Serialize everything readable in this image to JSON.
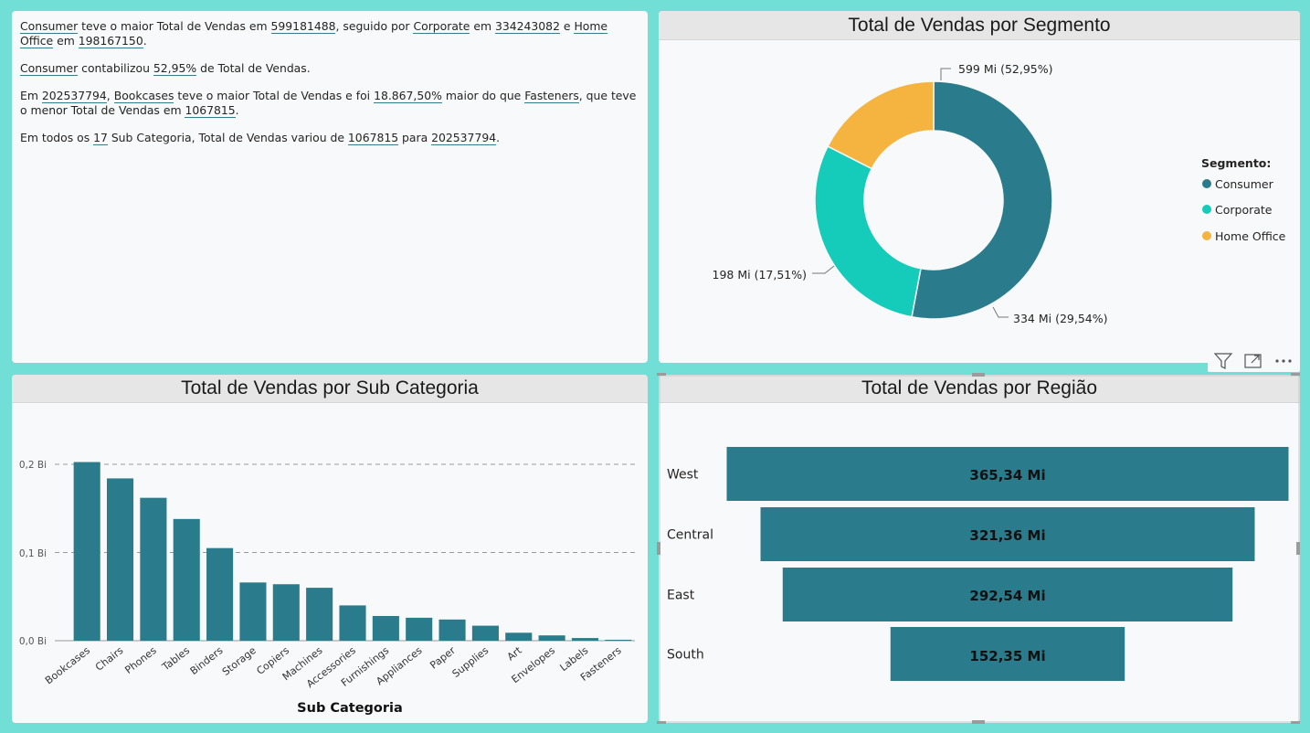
{
  "narrative": {
    "p1": {
      "a": "Consumer",
      "b": " teve o maior Total de Vendas em ",
      "c": "599181488",
      "d": ", seguido por ",
      "e": "Corporate",
      "f": " em ",
      "g": "334243082",
      "h": " e ",
      "i": "Home Office",
      "j": " em ",
      "k": "198167150",
      "l": "."
    },
    "p2": {
      "a": "Consumer",
      "b": " contabilizou ",
      "c": "52,95%",
      "d": " de Total de Vendas."
    },
    "p3": {
      "a": "Em ",
      "b": "202537794",
      "c": ", ",
      "d": "Bookcases",
      "e": " teve o maior Total de Vendas e foi ",
      "f": "18.867,50%",
      "g": " maior do que ",
      "h": "Fasteners",
      "i": ", que teve o menor Total de Vendas em ",
      "j": "1067815",
      "k": "."
    },
    "p4": {
      "a": "Em todos os ",
      "b": "17",
      "c": " Sub Categoria, Total de Vendas variou de ",
      "d": "1067815",
      "e": " para ",
      "f": "202537794",
      "g": "."
    }
  },
  "segment_chart": {
    "title": "Total de Vendas por Segmento",
    "legend_title": "Segmento:",
    "legend_items": [
      "Consumer",
      "Corporate",
      "Home Office"
    ],
    "slice_labels": [
      "599 Mi (52,95%)",
      "334 Mi (29,54%)",
      "198 Mi (17,51%)"
    ]
  },
  "subcat_chart": {
    "title": "Total de Vendas por Sub Categoria",
    "xlabel": "Sub Categoria",
    "tick_labels": [
      "0,0 Bi",
      "0,1 Bi",
      "0,2 Bi"
    ]
  },
  "region_chart": {
    "title": "Total de Vendas por Região",
    "bar_labels": [
      "365,34 Mi",
      "321,36 Mi",
      "292,54 Mi",
      "152,35 Mi"
    ]
  },
  "toolbar_icons": [
    "filter-icon",
    "focus-mode-icon",
    "more-options-icon"
  ],
  "colors": {
    "background": "#72DFD6",
    "primary_teal": "#2A7B8B",
    "corporate": "#15CBB9",
    "home_office": "#F4B43F"
  },
  "chart_data": [
    {
      "type": "pie",
      "title": "Total de Vendas por Segmento",
      "categories": [
        "Consumer",
        "Corporate",
        "Home Office"
      ],
      "values": [
        599181488,
        334243082,
        198167150
      ],
      "percent": [
        52.95,
        29.54,
        17.51
      ],
      "colors": [
        "#2A7B8B",
        "#15CBB9",
        "#F4B43F"
      ],
      "donut": true,
      "legend": "right"
    },
    {
      "type": "bar",
      "title": "Total de Vendas por Sub Categoria",
      "xlabel": "Sub Categoria",
      "ylabel": "",
      "categories": [
        "Bookcases",
        "Chairs",
        "Phones",
        "Tables",
        "Binders",
        "Storage",
        "Copiers",
        "Machines",
        "Accessories",
        "Furnishings",
        "Appliances",
        "Paper",
        "Supplies",
        "Art",
        "Envelopes",
        "Labels",
        "Fasteners"
      ],
      "values": [
        202537794,
        184000000,
        162000000,
        138000000,
        105000000,
        66000000,
        64000000,
        60000000,
        40000000,
        28000000,
        26000000,
        24000000,
        17000000,
        9000000,
        6000000,
        3000000,
        1067815
      ],
      "ylim": [
        0,
        220000000
      ],
      "yticks": [
        0,
        100000000,
        200000000
      ],
      "grid": true
    },
    {
      "type": "bar",
      "title": "Total de Vendas por Região",
      "orientation": "funnel",
      "categories": [
        "West",
        "Central",
        "East",
        "South"
      ],
      "values": [
        365.34,
        321.36,
        292.54,
        152.35
      ],
      "unit": "Mi"
    }
  ]
}
